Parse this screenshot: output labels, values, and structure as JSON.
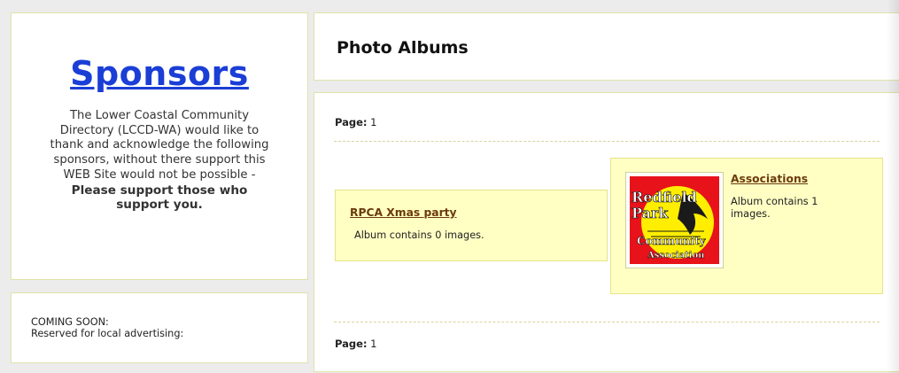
{
  "sponsors": {
    "title": "Sponsors",
    "line1": "The Lower Coastal Community",
    "line2": "Directory (LCCD-WA) would like to",
    "line3": "thank and acknowledge the following",
    "line4": "sponsors, without there support this",
    "line5": "WEB Site would not be possible -",
    "strong1": "Please support those who",
    "strong2": "support you."
  },
  "advert": {
    "line1": "COMING SOON:",
    "line2": "Reserved for local advertising:"
  },
  "albums_header": {
    "title": "Photo Albums"
  },
  "pager": {
    "label": "Page:",
    "value": "1"
  },
  "albums": [
    {
      "name": "RPCA Xmas party",
      "count_text": "Album contains 0 images."
    },
    {
      "name": "Associations",
      "count_text": "Album contains 1 images.",
      "thumbnail_logo": {
        "line1": "Redfield",
        "line2": "Park",
        "line3": "Community",
        "line4": "Association"
      }
    }
  ],
  "colors": {
    "sponsor_link": "#1a3ed6",
    "album_link": "#6b3a0b",
    "album_bg": "#ffffc4",
    "logo_red": "#e8121a",
    "logo_yellow": "#ffee00"
  }
}
